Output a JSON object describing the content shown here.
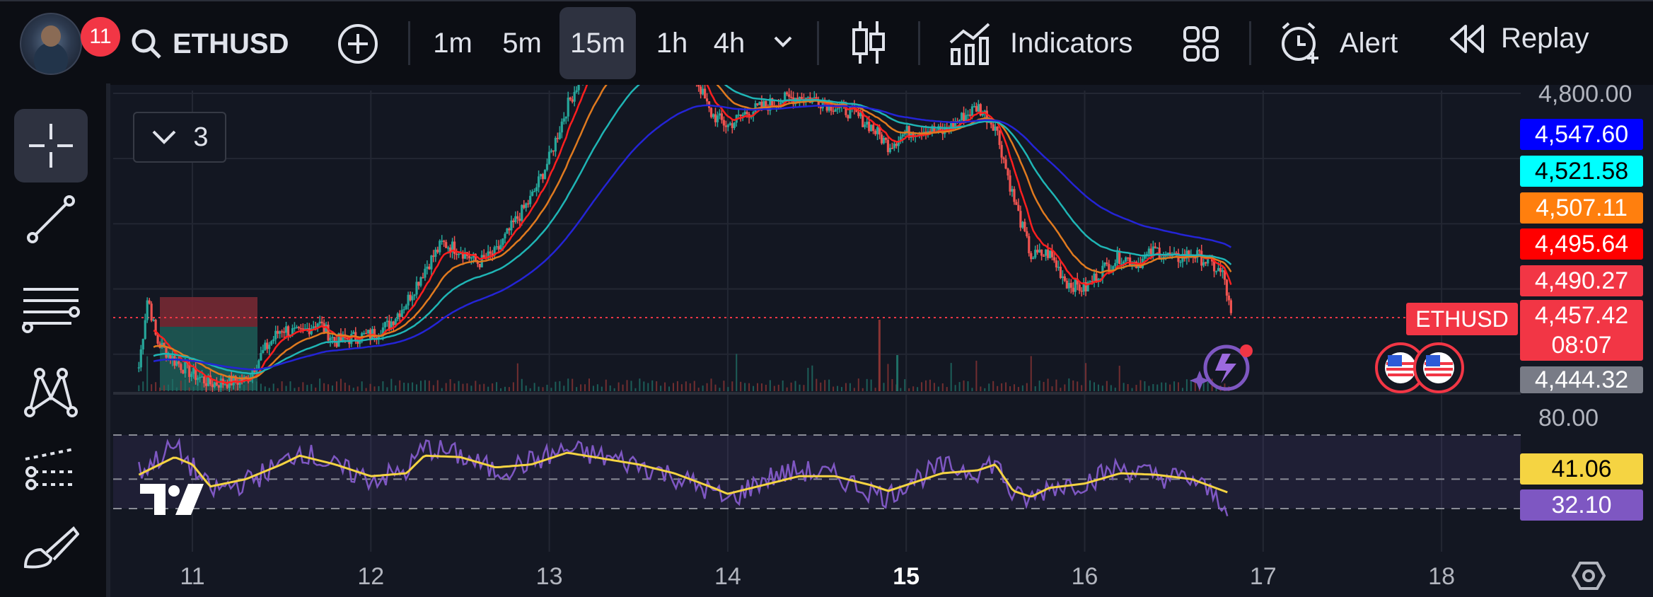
{
  "toolbar": {
    "notification_count": "11",
    "symbol": "ETHUSD",
    "timeframes": [
      "1m",
      "5m",
      "15m",
      "1h",
      "4h"
    ],
    "active_timeframe": "15m",
    "indicators_label": "Indicators",
    "alert_label": "Alert",
    "replay_label": "Replay"
  },
  "legend": {
    "collapsed_count": "3"
  },
  "symbol_tag": "ETHUSD",
  "price_badges": {
    "ma_blue": "4,547.60",
    "ma_cyan": "4,521.58",
    "ma_orange": "4,507.11",
    "ma_red": "4,495.64",
    "ma_light_red": "4,490.27",
    "last_price": "4,457.42",
    "countdown": "08:07",
    "gray_level": "4,444.32",
    "rsi_ma": "41.06",
    "rsi": "32.10"
  },
  "colors": {
    "background": "#131722",
    "up": "#26a69a",
    "down": "#ef5350",
    "ma_blue": "#2424d6",
    "ma_cyan": "#1fb5b5",
    "ma_orange": "#e07a1f",
    "ma_red": "#ff1f1f",
    "rsi_line": "#7e57c2",
    "rsi_ma_line": "#f5d442"
  },
  "chart_data": {
    "type": "candlestick",
    "symbol": "ETHUSD",
    "interval": "15m",
    "x_ticks": [
      "11",
      "12",
      "13",
      "14",
      "15",
      "16",
      "17",
      "18"
    ],
    "y_top_label": "4,800.00",
    "rsi_level_label": "80.00",
    "price_series": {
      "x": [
        10.7,
        10.75,
        10.8,
        10.9,
        11.0,
        11.1,
        11.3,
        11.4,
        11.5,
        11.6,
        11.7,
        11.8,
        11.9,
        12.0,
        12.1,
        12.2,
        12.3,
        12.4,
        12.5,
        12.6,
        12.7,
        12.8,
        12.9,
        13.0,
        13.1,
        13.2,
        13.3,
        13.4,
        13.5,
        13.6,
        13.7,
        13.8,
        13.9,
        14.0,
        14.1,
        14.2,
        14.3,
        14.4,
        14.5,
        14.6,
        14.7,
        14.8,
        14.9,
        15.0,
        15.1,
        15.2,
        15.3,
        15.4,
        15.5,
        15.6,
        15.7,
        15.8,
        15.9,
        16.0,
        16.1,
        16.2,
        16.3,
        16.4,
        16.5,
        16.6,
        16.7,
        16.78,
        16.82
      ],
      "close": [
        4380,
        4490,
        4420,
        4390,
        4370,
        4355,
        4360,
        4405,
        4440,
        4430,
        4450,
        4420,
        4425,
        4430,
        4445,
        4480,
        4530,
        4570,
        4560,
        4540,
        4555,
        4600,
        4640,
        4700,
        4780,
        4840,
        4870,
        4900,
        4890,
        4875,
        4860,
        4840,
        4770,
        4750,
        4770,
        4780,
        4790,
        4795,
        4790,
        4780,
        4770,
        4750,
        4720,
        4740,
        4745,
        4740,
        4760,
        4780,
        4750,
        4640,
        4550,
        4555,
        4510,
        4500,
        4530,
        4550,
        4540,
        4560,
        4545,
        4555,
        4540,
        4520,
        4457.42
      ]
    },
    "moving_averages": [
      {
        "color": "#ff1f1f",
        "last": 4495.64
      },
      {
        "color": "#e07a1f",
        "last": 4507.11
      },
      {
        "color": "#1fb5b5",
        "last": 4521.58
      },
      {
        "color": "#2424d6",
        "last": 4547.6
      }
    ],
    "rsi": {
      "levels": [
        80,
        50,
        30
      ],
      "x": [
        10.7,
        10.9,
        11.0,
        11.1,
        11.3,
        11.5,
        11.6,
        11.8,
        12.0,
        12.2,
        12.3,
        12.5,
        12.7,
        12.9,
        13.1,
        13.3,
        13.5,
        13.7,
        13.9,
        14.0,
        14.2,
        14.4,
        14.6,
        14.8,
        14.9,
        15.0,
        15.2,
        15.4,
        15.5,
        15.6,
        15.7,
        15.8,
        16.0,
        16.2,
        16.4,
        16.6,
        16.8
      ],
      "rsi": [
        55,
        72,
        58,
        42,
        48,
        60,
        70,
        58,
        50,
        55,
        72,
        66,
        55,
        62,
        70,
        65,
        60,
        52,
        42,
        35,
        50,
        56,
        52,
        42,
        38,
        48,
        58,
        56,
        62,
        38,
        36,
        45,
        48,
        58,
        52,
        50,
        32.1
      ],
      "rsi_ma": [
        53,
        65,
        60,
        45,
        50,
        60,
        66,
        60,
        52,
        54,
        66,
        65,
        58,
        60,
        68,
        64,
        60,
        54,
        45,
        40,
        46,
        52,
        52,
        46,
        42,
        46,
        54,
        56,
        60,
        42,
        38,
        44,
        47,
        54,
        53,
        50,
        41.06
      ]
    }
  }
}
